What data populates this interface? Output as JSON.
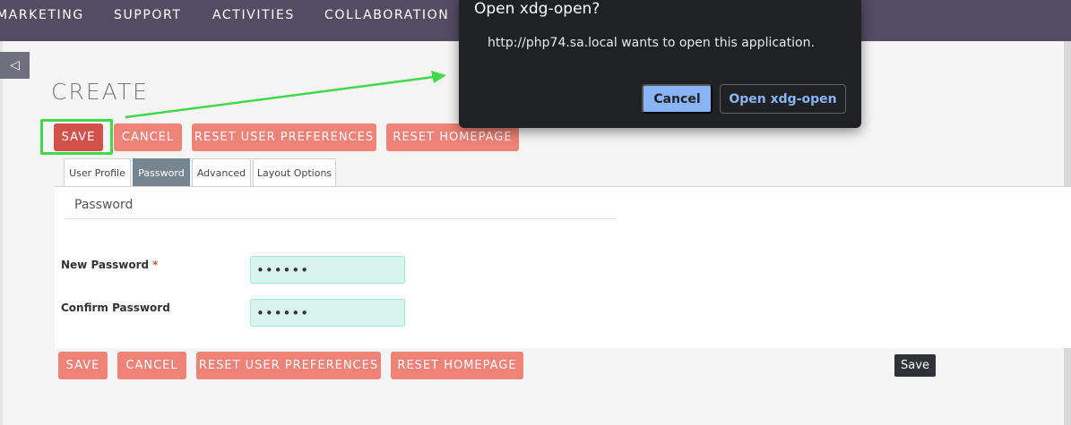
{
  "nav": {
    "items": [
      "MARKETING",
      "SUPPORT",
      "ACTIVITIES",
      "COLLABORATION"
    ],
    "sidebar_toggle": "◁"
  },
  "page": {
    "title": "CREATE"
  },
  "buttons_top": {
    "save": "SAVE",
    "cancel": "CANCEL",
    "reset_prefs": "RESET USER PREFERENCES",
    "reset_home": "RESET HOMEPAGE"
  },
  "tabs": [
    {
      "label": "User Profile",
      "active": false
    },
    {
      "label": "Password",
      "active": true
    },
    {
      "label": "Advanced",
      "active": false
    },
    {
      "label": "Layout Options",
      "active": false
    }
  ],
  "panel": {
    "heading": "Password",
    "new_password": {
      "label": "New Password",
      "required_mark": "*",
      "value": "••••••"
    },
    "confirm_password": {
      "label": "Confirm Password",
      "value": "••••••"
    }
  },
  "buttons_bottom": {
    "save": "SAVE",
    "cancel": "CANCEL",
    "reset_prefs": "RESET USER PREFERENCES",
    "reset_home": "RESET HOMEPAGE"
  },
  "tooltip": {
    "text": "Save"
  },
  "dialog": {
    "title": "Open xdg-open?",
    "message": "http://php74.sa.local wants to open this application.",
    "cancel_label": "Cancel",
    "open_label": "Open xdg-open"
  },
  "colors": {
    "nav_bg": "#534d64",
    "button": "#f08377",
    "button_active": "#d2514a",
    "highlight": "#3fd94a",
    "dialog_bg": "#202124",
    "dialog_accent": "#8ab4f8"
  }
}
